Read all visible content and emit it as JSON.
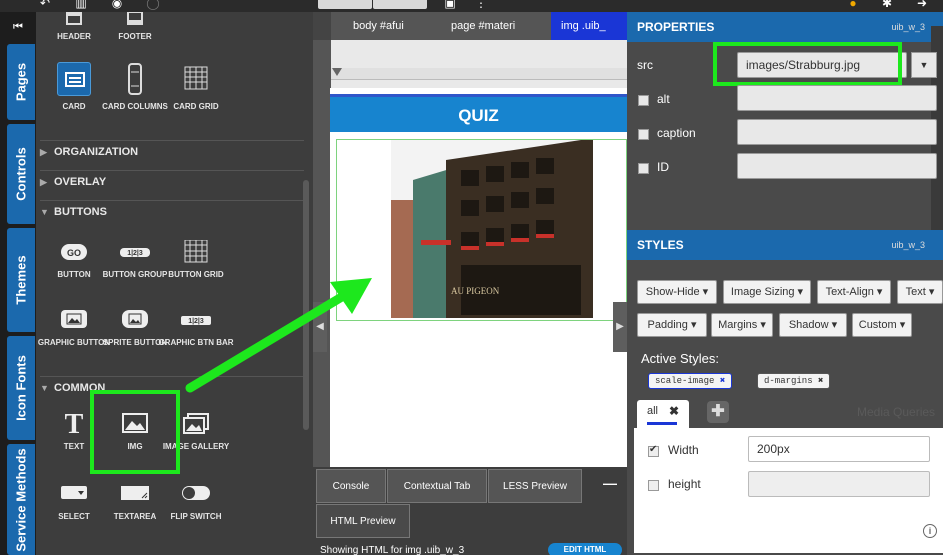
{
  "palette": {
    "top_widgets": [
      "HEADER",
      "FOOTER"
    ],
    "card_widgets": [
      {
        "label": "CARD",
        "icon": "card-icon"
      },
      {
        "label": "CARD COLUMNS",
        "icon": "card-columns-icon"
      },
      {
        "label": "CARD GRID",
        "icon": "card-grid-icon"
      }
    ],
    "sections": [
      "ORGANIZATION",
      "OVERLAY",
      "BUTTONS",
      "COMMON"
    ],
    "button_widgets": [
      {
        "label": "BUTTON",
        "icon": "button-icon"
      },
      {
        "label": "BUTTON GROUP",
        "icon": "button-group-icon"
      },
      {
        "label": "BUTTON GRID",
        "icon": "button-grid-icon"
      },
      {
        "label": "GRAPHIC BUTTON",
        "icon": "graphic-button-icon"
      },
      {
        "label": "SPRITE BUTTON",
        "icon": "sprite-button-icon"
      },
      {
        "label": "GRAPHIC BTN BAR",
        "icon": "graphic-btn-bar-icon"
      }
    ],
    "common_widgets": [
      {
        "label": "TEXT",
        "icon": "text-icon"
      },
      {
        "label": "IMG",
        "icon": "image-icon"
      },
      {
        "label": "IMAGE GALLERY",
        "icon": "image-gallery-icon"
      },
      {
        "label": "SELECT",
        "icon": "select-icon"
      },
      {
        "label": "TEXTAREA",
        "icon": "textarea-icon"
      },
      {
        "label": "FLIP SWITCH",
        "icon": "flip-switch-icon"
      }
    ]
  },
  "vtabs": [
    "Pages",
    "Controls",
    "Themes",
    "Icon Fonts",
    "Service Methods"
  ],
  "breadcrumbs": [
    "body #afui",
    "page #materi",
    "img .uib_"
  ],
  "canvas": {
    "quiz_title": "QUIZ",
    "photo_sign": "AU PIGEON"
  },
  "console_tabs": [
    "Console",
    "Contextual Tab",
    "LESS Preview",
    "HTML Preview"
  ],
  "console_minimize": "—",
  "status_text": "Showing HTML for img .uib_w_3",
  "edit_html_label": "EDIT HTML",
  "properties": {
    "title": "PROPERTIES",
    "element_id": "uib_w_3",
    "src_label": "src",
    "src_value": "images/Strabburg.jpg",
    "alt_label": "alt",
    "caption_label": "caption",
    "id_label": "ID"
  },
  "styles": {
    "title": "STYLES",
    "element_id": "uib_w_3",
    "buttons_row1": [
      "Show-Hide",
      "Image Sizing",
      "Text-Align",
      "Text"
    ],
    "buttons_row2": [
      "Padding",
      "Margins",
      "Shadow",
      "Custom"
    ],
    "active_label": "Active Styles:",
    "active_chips": [
      "scale-image",
      "d-margins"
    ],
    "media_tab": "all",
    "media_queries_label": "Media Queries",
    "width_label": "Width",
    "width_value": "200px",
    "width_checked": true,
    "height_label": "height",
    "height_value": "",
    "height_checked": false
  },
  "colors": {
    "accent_blue": "#1b69ad",
    "highlight_green": "#1de81d",
    "active_crumb": "#1a36d6"
  }
}
